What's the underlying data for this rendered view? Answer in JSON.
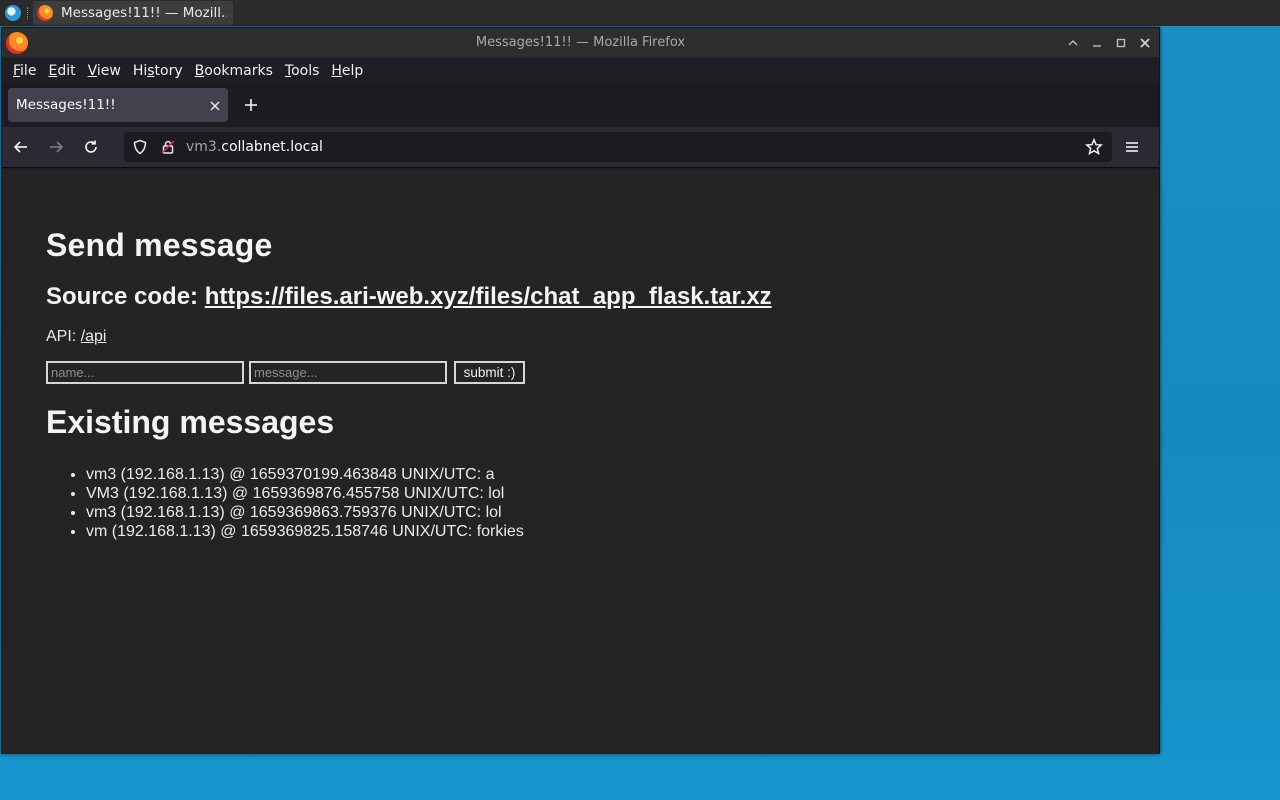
{
  "taskbar": {
    "task_label": "Messages!11!! — Mozill..."
  },
  "window": {
    "title": "Messages!11!! — Mozilla Firefox"
  },
  "menubar": {
    "items": [
      {
        "pre": "",
        "u": "F",
        "post": "ile"
      },
      {
        "pre": "",
        "u": "E",
        "post": "dit"
      },
      {
        "pre": "",
        "u": "V",
        "post": "iew"
      },
      {
        "pre": "Hi",
        "u": "s",
        "post": "tory"
      },
      {
        "pre": "",
        "u": "B",
        "post": "ookmarks"
      },
      {
        "pre": "",
        "u": "T",
        "post": "ools"
      },
      {
        "pre": "",
        "u": "H",
        "post": "elp"
      }
    ]
  },
  "tabs": [
    {
      "title": "Messages!11!!"
    }
  ],
  "urlbar": {
    "host_dim": "vm3.",
    "host_main": "collabnet.local"
  },
  "page": {
    "heading": "Send message",
    "source_prefix": "Source code: ",
    "source_link": "https://files.ari-web.xyz/files/chat_app_flask.tar.xz",
    "api_prefix": "API: ",
    "api_link": "/api",
    "name_placeholder": "name...",
    "message_placeholder": "message...",
    "submit_label": "submit :)",
    "existing_heading": "Existing messages",
    "messages": [
      "vm3 (192.168.1.13) @ 1659370199.463848 UNIX/UTC: a",
      "VM3 (192.168.1.13) @ 1659369876.455758 UNIX/UTC: lol",
      "vm3 (192.168.1.13) @ 1659369863.759376 UNIX/UTC: lol",
      "vm (192.168.1.13) @ 1659369825.158746 UNIX/UTC: forkies"
    ]
  }
}
